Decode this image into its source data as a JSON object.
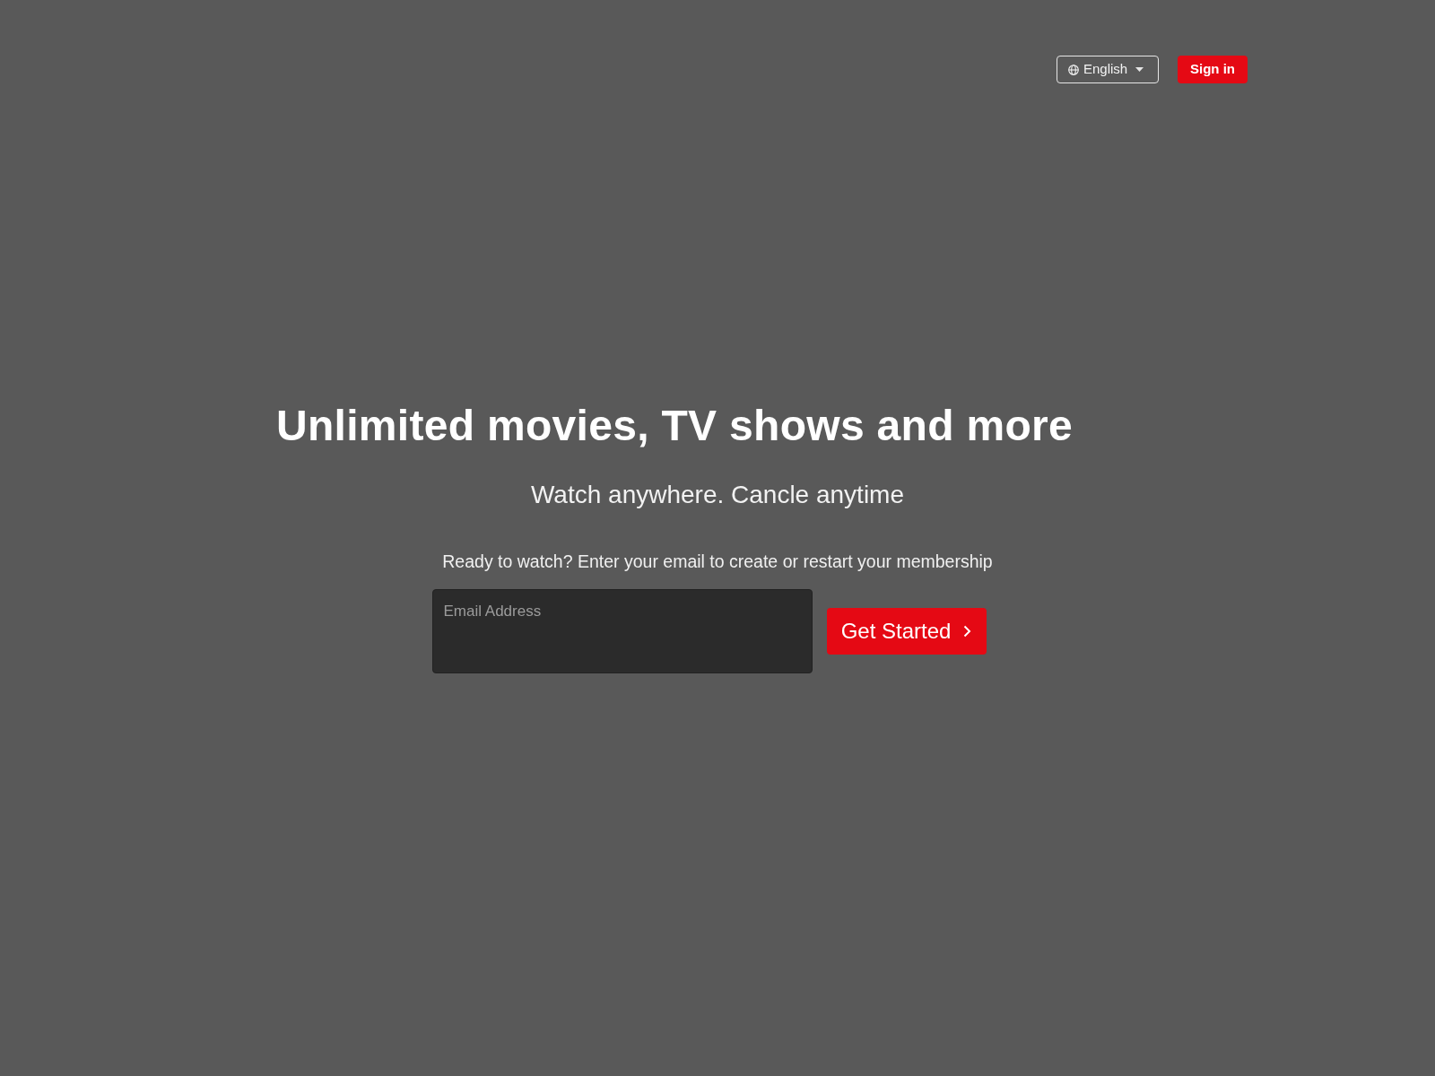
{
  "header": {
    "language_selector": {
      "label": "English"
    },
    "sign_in_button": {
      "label": "Sign in"
    }
  },
  "hero": {
    "title": "Unlimited movies, TV shows and more",
    "subtitle": "Watch anywhere. Cancle anytime",
    "prompt": "Ready to watch? Enter your email to create or restart your membership",
    "email_field": {
      "placeholder": "Email Address"
    },
    "cta_button": {
      "label": "Get Started"
    }
  }
}
